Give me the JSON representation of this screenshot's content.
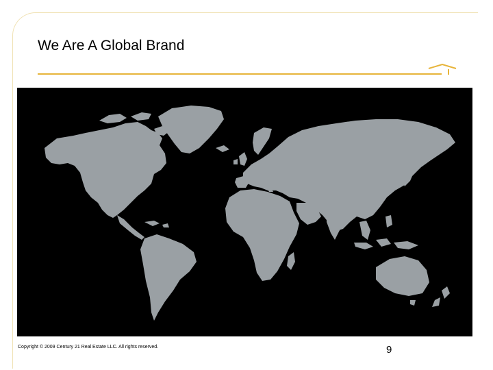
{
  "slide": {
    "title": "We Are A Global Brand",
    "footer": {
      "copyright": "Copyright © 2009 Century 21 Real Estate LLC. All rights reserved.",
      "page_number": "9"
    },
    "map": {
      "image": "world-map",
      "background_color": "#000000",
      "land_color": "#9aa0a4"
    },
    "accent_color": "#e7b43a"
  }
}
